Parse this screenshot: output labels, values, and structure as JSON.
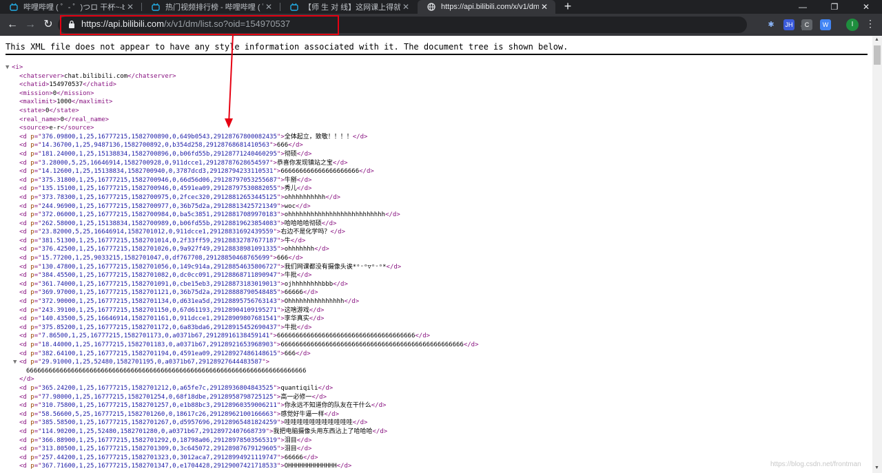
{
  "browser": {
    "tabs": [
      {
        "title": "哔哩哔哩 ( ゜- ゜)つロ 干杯~-bili",
        "active": false
      },
      {
        "title": "热门视频排行榜 - 哔哩哔哩 ( ゜- ゜",
        "active": false
      },
      {
        "title": "【师 生 对 线】这网课上得就尼玛",
        "active": false
      },
      {
        "title": "https://api.bilibili.com/x/v1/dm",
        "active": true
      }
    ],
    "new_tab": "+",
    "url_host": "https://api.bilibili.com",
    "url_path": "/x/v1/dm/list.so?oid=154970537",
    "extensions": [
      "JH",
      "C",
      "W"
    ],
    "profile_initial": "I"
  },
  "page": {
    "notice": "This XML file does not appear to have any style information associated with it. The document tree is shown below.",
    "root_tag": "i",
    "meta": [
      {
        "tag": "chatserver",
        "value": "chat.bilibili.com"
      },
      {
        "tag": "chatid",
        "value": "154970537"
      },
      {
        "tag": "mission",
        "value": "0"
      },
      {
        "tag": "maxlimit",
        "value": "1000"
      },
      {
        "tag": "state",
        "value": "0"
      },
      {
        "tag": "real_name",
        "value": "0"
      },
      {
        "tag": "source",
        "value": "e-r"
      }
    ],
    "danmaku": [
      {
        "p": "376.09800,1,25,16777215,1582700890,0,649b0543,29128767800082435",
        "text": "全体起立，致敬！！！！"
      },
      {
        "p": "14.36700,1,25,9487136,1582700892,0,b354d258,29128768681410563",
        "text": "666"
      },
      {
        "p": "181.24000,1,25,15138834,1582700896,0,b06fd55b,29128771240460295",
        "text": "彻硕"
      },
      {
        "p": "3.28000,5,25,16646914,1582700928,0,911dcce1,29128787628654597",
        "text": "恭喜你发现镇站之宝"
      },
      {
        "p": "14.12600,1,25,15138834,1582700940,0,3787dcd3,29128794233110531",
        "text": "666666666666666666666"
      },
      {
        "p": "375.31800,1,25,16777215,1582700946,0,66d56d06,29128797053255687",
        "text": "牛掰"
      },
      {
        "p": "135.15100,1,25,16777215,1582700946,0,4591ea09,29128797530882055",
        "text": "秀儿"
      },
      {
        "p": "373.78300,1,25,16777215,1582700975,0,2fcec320,29128812653445125",
        "text": "ohhhhhhhhhh"
      },
      {
        "p": "244.96900,1,25,16777215,1582700977,0,36b75d2a,29128813425721349",
        "text": "woc"
      },
      {
        "p": "372.06000,1,25,16777215,1582700984,0,ba5c3851,29128817089970183",
        "text": "ohhhhhhhhhhhhhhhhhhhhhhhhhh"
      },
      {
        "p": "262.58000,1,25,15138834,1582700989,0,b06fd55b,29128819623854083",
        "text": "哈哈哈哈彻硕"
      },
      {
        "p": "23.82000,5,25,16646914,1582701012,0,911dcce1,29128831692439559",
        "text": "右边不是化学吗？"
      },
      {
        "p": "381.51300,1,25,16777215,1582701014,0,2f33ff59,29128832787677187",
        "text": "牛"
      },
      {
        "p": "376.42500,1,25,16777215,1582701026,0,9a927f49,29128838981091335",
        "text": "ohhhhhhh"
      },
      {
        "p": "15.77200,1,25,9033215,1582701047,0,df767708,29128850468765699",
        "text": "666"
      },
      {
        "p": "130.47800,1,25,16777215,1582701056,0,149c914a,29128854635806727",
        "text": "我们网课都没有摄像头诶*ᵒᵕᵒ▽ᵒᵕᵒ*"
      },
      {
        "p": "384.45500,1,25,16777215,1582701082,0,dc0cc091,29128868711890947",
        "text": "牛批"
      },
      {
        "p": "361.74000,1,25,16777215,1582701091,0,cbe15eb3,29128873183019013",
        "text": "ojhhhhhhhhbbb"
      },
      {
        "p": "369.97000,1,25,16777215,1582701121,0,36b75d2a,29128888790548485",
        "text": "66666"
      },
      {
        "p": "372.90000,1,25,16777215,1582701134,0,d631ea5d,29128895756763143",
        "text": "Ohhhhhhhhhhhhhhh"
      },
      {
        "p": "243.39100,1,25,16777215,1582701150,0,67d61193,29128904109195271",
        "text": "这啥游戏"
      },
      {
        "p": "140.43500,5,25,16646914,1582701161,0,911dcce1,29128909807681541",
        "text": "李华真实"
      },
      {
        "p": "375.85200,1,25,16777215,1582701172,0,6a83bda6,29128915452690437",
        "text": "牛批"
      },
      {
        "p": "7.86500,1,25,16777215,1582701173,0,a0371b67,29128916138459141",
        "text": "6666666666666666666666666666666666666"
      },
      {
        "p": "18.44000,1,25,16777215,1582701183,0,a0371b67,29128921653968903",
        "text": "6666666666666666666666666666666666666666666666666"
      },
      {
        "p": "382.64100,1,25,16777215,1582701194,0,4591ea09,29128927486148615",
        "text": "666"
      },
      {
        "p": "29.91000,1,25,52480,1582701195,0,a0371b67,29128927644483587",
        "text": "666666666666666666666666666666666666666666666666666666666666666666666666666",
        "expanded": true
      },
      {
        "p": "365.24200,1,25,16777215,1582701212,0,a65fe7c,29128936804843525",
        "text": "quantiqili"
      },
      {
        "p": "77.98000,1,25,16777215,1582701254,0,68f18dbe,29128958798725125",
        "text": "高一必修一"
      },
      {
        "p": "310.75800,1,25,16777215,1582701257,0,e1b88bc3,29128960359006211",
        "text": "你永远不知道你的队友在干什么"
      },
      {
        "p": "58.56600,5,25,16777215,1582701260,0,18617c26,29128962100166663",
        "text": "感觉好牛逼一样"
      },
      {
        "p": "385.58500,1,25,16777215,1582701267,0,d5957696,29128965481824259",
        "text": "哇哇哇哇哇哇哇哇哇哇哇"
      },
      {
        "p": "114.90200,1,25,52480,1582701280,0,a0371b67,29128972407668739",
        "text": "我把电脑摄像头用东西沾上了哈哈哈"
      },
      {
        "p": "366.88900,1,25,16777215,1582701292,0,18798a06,29128978503565319",
        "text": "泪目"
      },
      {
        "p": "313.80500,1,25,16777215,1582701309,0,3c645072,29128987679129605",
        "text": "泪目"
      },
      {
        "p": "257.44200,1,25,16777215,1582701323,0,3012aca7,29128994921119747",
        "text": "66666"
      },
      {
        "p": "367.71600,1,25,16777215,1582701347,0,e1704428,29129007421718533",
        "text": "OHHHHHHHHHHHHH"
      }
    ]
  },
  "watermark": "https://blog.csdn.net/frontman"
}
